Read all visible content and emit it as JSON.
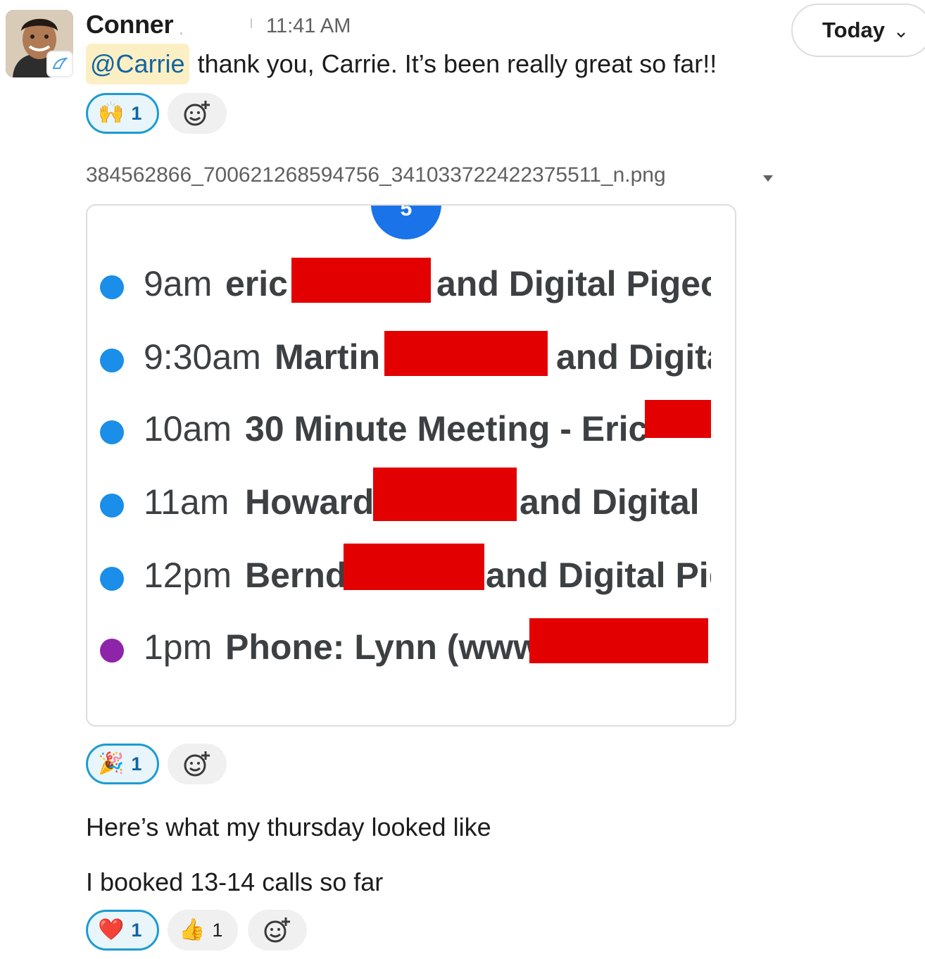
{
  "message": {
    "sender": "Conner",
    "timestamp": "11:41 AM",
    "mention": "@Carrie",
    "text": "thank you, Carrie. It’s been really great so far!!",
    "reactions": [
      {
        "emoji": "🙌",
        "count": "1",
        "active": true
      }
    ]
  },
  "date_divider": {
    "label": "Today"
  },
  "attachment": {
    "filename": "384562866_700621268594756_3410337224223755​11_n.png",
    "calendar_day_badge": "5",
    "events": [
      {
        "time": "9am",
        "title": "eric",
        "tail": "and Digital Pigeo",
        "dot_color": "#1a8ee8"
      },
      {
        "time": "9:30am",
        "title": "Martin",
        "tail": "and Digita",
        "dot_color": "#1a8ee8"
      },
      {
        "time": "10am",
        "title": "30 Minute Meeting - Eric",
        "tail": "",
        "dot_color": "#1a8ee8"
      },
      {
        "time": "11am",
        "title": "Howard",
        "tail": "and Digital F",
        "dot_color": "#1a8ee8"
      },
      {
        "time": "12pm",
        "title": "Bernd",
        "tail": "and Digital Pig",
        "dot_color": "#1a8ee8"
      },
      {
        "time": "1pm",
        "title": "Phone: Lynn (www.",
        "tail": "",
        "dot_color": "#8e24aa"
      }
    ],
    "reactions": [
      {
        "emoji": "🎉",
        "count": "1",
        "active": true
      }
    ]
  },
  "followups": [
    {
      "text": "Here’s what my thursday looked like"
    },
    {
      "text": "I booked 13-14 calls so far"
    }
  ],
  "final_reactions": [
    {
      "emoji": "❤️",
      "count": "1",
      "active": true
    },
    {
      "emoji": "👍",
      "count": "1",
      "active": false
    }
  ],
  "colors": {
    "mention_bg": "#fcefc3",
    "mention_text": "#1264a3",
    "reaction_active_border": "#1d9bd1",
    "redaction": "#e30000",
    "calendar_blue": "#1a73e8"
  }
}
